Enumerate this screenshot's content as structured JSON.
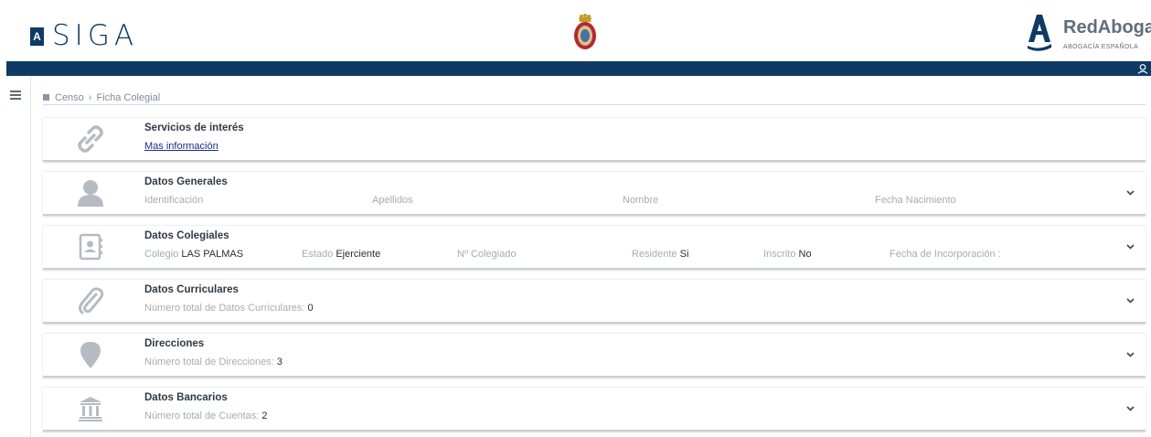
{
  "header": {
    "siga_box": "A",
    "siga_text": "SIGA",
    "red_abogacia": "RedAbogacía",
    "red_abogacia_sub": "ABOGACÍA ESPAÑOLA"
  },
  "breadcrumb": {
    "root": "Censo",
    "current": "Ficha Colegial"
  },
  "cards": {
    "servicios": {
      "title": "Servicios de interés",
      "link": "Mas información"
    },
    "generales": {
      "title": "Datos Generales",
      "fields": {
        "identificacion": "Identificación",
        "apellidos": "Apellidos",
        "nombre": "Nombre",
        "fecha_nacimiento": "Fecha Nacimiento"
      }
    },
    "colegiales": {
      "title": "Datos Colegiales",
      "colegio_label": "Colegio",
      "colegio_value": "LAS PALMAS",
      "estado_label": "Estado",
      "estado_value": "Ejerciente",
      "n_colegiado_label": "Nº Colegiado",
      "residente_label": "Residente",
      "residente_value": "Si",
      "inscrito_label": "Inscrito",
      "inscrito_value": "No",
      "fecha_incorp_label": "Fecha de Incorporación :"
    },
    "curriculares": {
      "title": "Datos Curriculares",
      "count_label": "Número total de Datos Curriculares:",
      "count": "0"
    },
    "direcciones": {
      "title": "Direcciones",
      "count_label": "Número total de Direcciones:",
      "count": "3"
    },
    "bancarios": {
      "title": "Datos Bancarios",
      "count_label": "Número total de Cuentas:",
      "count": "2"
    }
  },
  "colors": {
    "primary": "#0e3a63",
    "icon_gray": "#b5bbc2",
    "link": "#1a2e8c"
  },
  "icons": [
    "link-icon",
    "user-icon",
    "id-card-icon",
    "paperclip-icon",
    "map-pin-icon",
    "bank-icon",
    "chevron-down-icon",
    "menu-icon",
    "crest-icon"
  ]
}
